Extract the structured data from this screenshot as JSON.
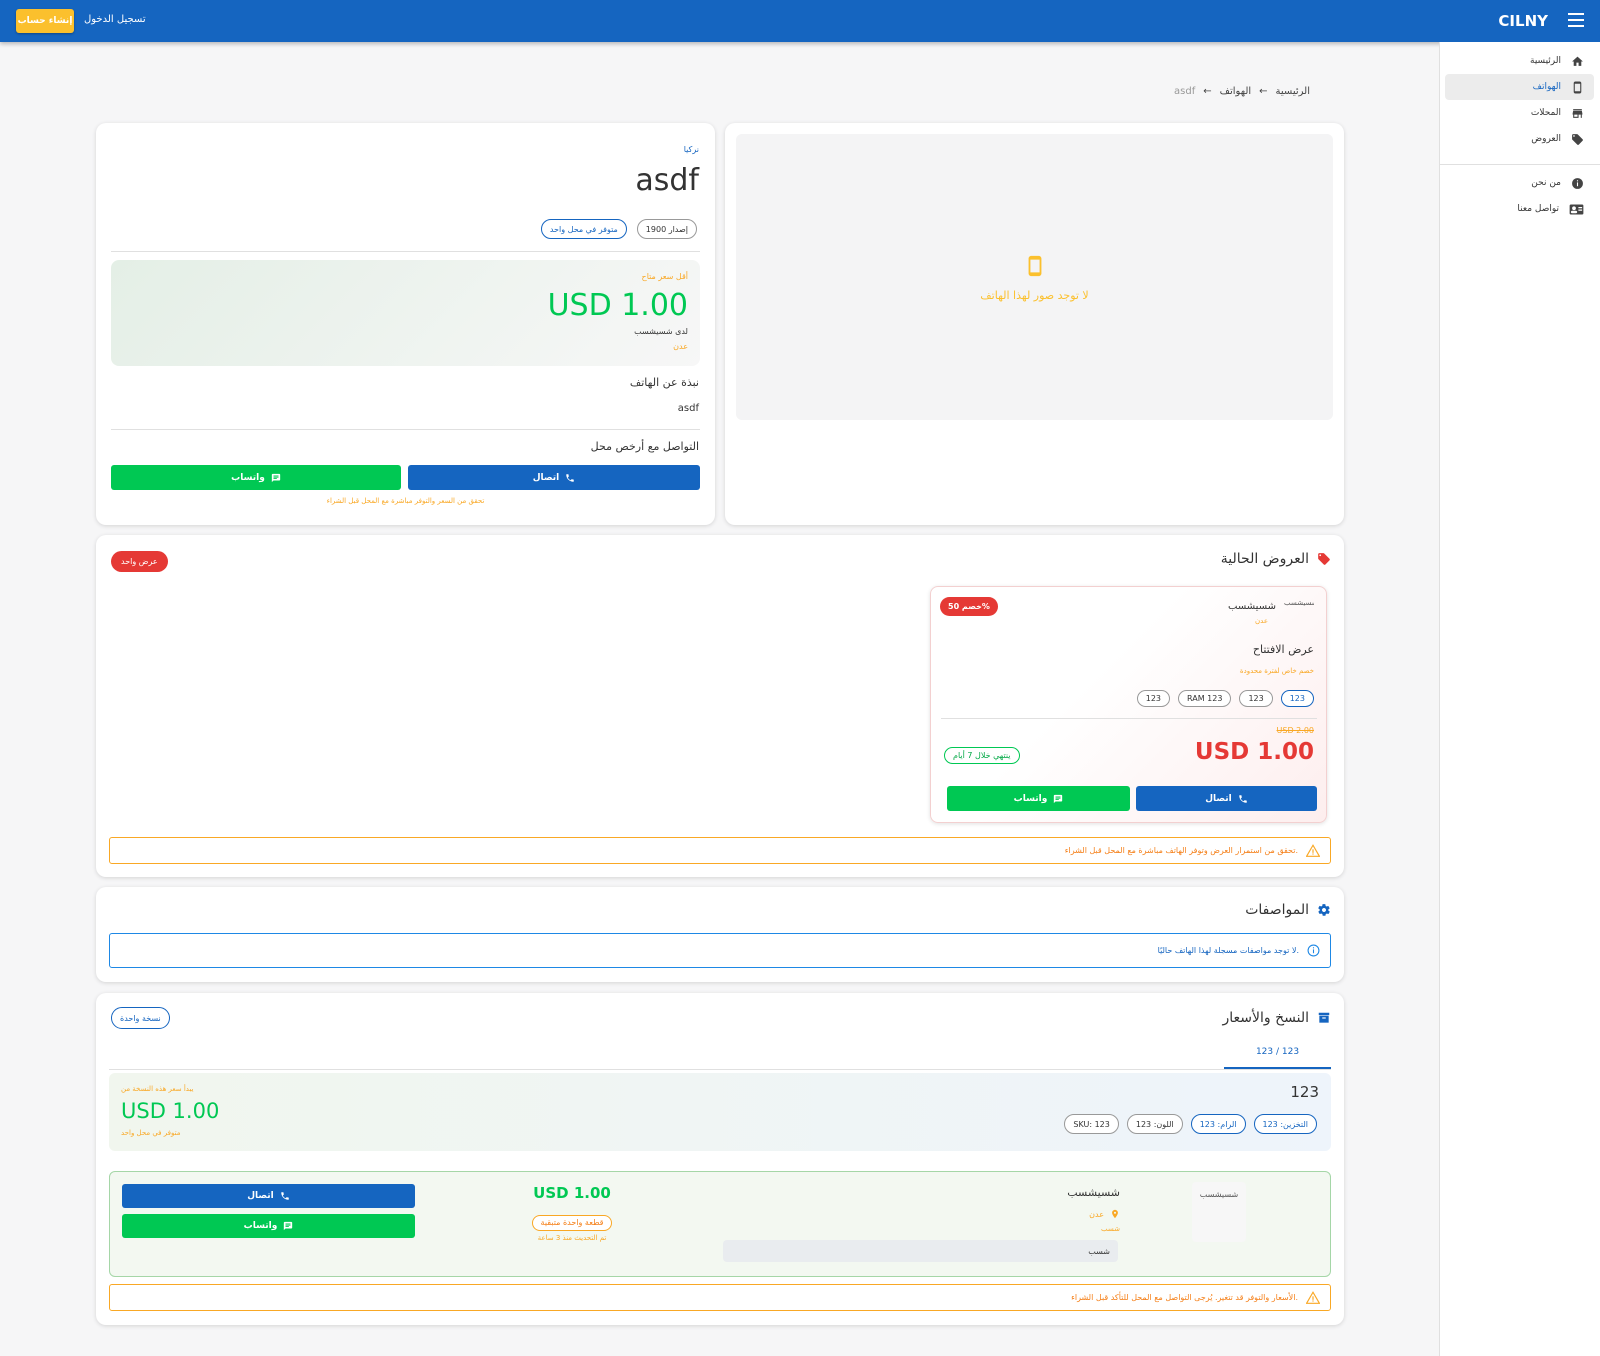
{
  "appbar": {
    "brand": "CILNY",
    "login_label": "تسجيل الدخول",
    "create_account_label": "إنشاء حساب"
  },
  "sidebar": {
    "items": [
      {
        "label": "الرئيسية",
        "icon": "home-icon"
      },
      {
        "label": "الهواتف",
        "icon": "phone-icon"
      },
      {
        "label": "المحلات",
        "icon": "store-icon"
      },
      {
        "label": "العروض",
        "icon": "tag-icon"
      }
    ],
    "secondary": [
      {
        "label": "من نحن",
        "icon": "info-icon"
      },
      {
        "label": "تواصل معنا",
        "icon": "contact-card-icon"
      }
    ]
  },
  "breadcrumb": {
    "home": "الرئيسية",
    "sep": "←",
    "phones": "الهواتف",
    "current": "asdf"
  },
  "product": {
    "brand": "نركيا",
    "name": "asdf",
    "release_chip": "إصدار 1900",
    "availability_chip": "متوفر في محل واحد",
    "lowest_price_label": "أقل سعر متاح",
    "lowest_price": "USD 1.00",
    "shop_name": "لدى شسيشسب",
    "shop_city": "عدن",
    "about_title": "نبذة عن الهاتف",
    "about_text": "asdf",
    "contact_title": "التواصل مع أرخص محل",
    "call_label": "اتصال",
    "whatsapp_label": "واتساب",
    "contact_note": "تحقق من السعر والتوفر مباشرة مع المحل قبل الشراء"
  },
  "gallery": {
    "empty_text": "لا توجد صور لهذا الهاتف"
  },
  "offers": {
    "title": "العروض الحالية",
    "count_badge": "عرض واحد",
    "card": {
      "discount_badge": "خصم 50%",
      "shop_name": "شسيشسب",
      "shop_logo_alt": "شسيشسب",
      "shop_city": "عدن",
      "title": "عرض الافتتاح",
      "subtitle": "خصم خاص لفترة محدودة",
      "chips": [
        "123",
        "123",
        "RAM 123",
        "123"
      ],
      "old_price": "USD 2.00",
      "price": "USD 1.00",
      "ends_chip": "ينتهي خلال 7 أيام",
      "call_label": "اتصال",
      "whatsapp_label": "واتساب"
    },
    "warning": "تحقق من استمرار العرض وتوفر الهاتف مباشرة مع المحل قبل الشراء."
  },
  "specs": {
    "title": "المواصفات",
    "empty_info": "لا توجد مواصفات مسجلة لهذا الهاتف حاليًا."
  },
  "variants": {
    "title": "النسخ والأسعار",
    "count_badge": "نسخة واحدة",
    "tab": "123 / 123",
    "variant_name": "123",
    "chips": [
      "التخزين: 123",
      "الرام: 123",
      "اللون: 123",
      "SKU: 123"
    ],
    "starting_label": "يبدأ سعر هذه النسخة من",
    "starting_price": "USD 1.00",
    "availability": "متوفر في محل واحد",
    "listing": {
      "shop_logo_alt": "شسيشسب",
      "shop_name": "شسيشسب",
      "city": "عدن",
      "district": "شسب",
      "address": "شسب",
      "price": "USD 1.00",
      "stock_chip": "قطعة واحدة متبقية",
      "updated": "تم التحديث منذ 3 ساعة",
      "call_label": "اتصال",
      "whatsapp_label": "واتساب"
    },
    "warning": "الأسعار والتوفر قد تتغير. يُرجى التواصل مع المحل للتأكد قبل الشراء."
  },
  "colors": {
    "primary": "#1565c0",
    "accent": "#fbc02d",
    "success": "#00c853",
    "danger": "#e53935",
    "warning": "#f9a825"
  }
}
